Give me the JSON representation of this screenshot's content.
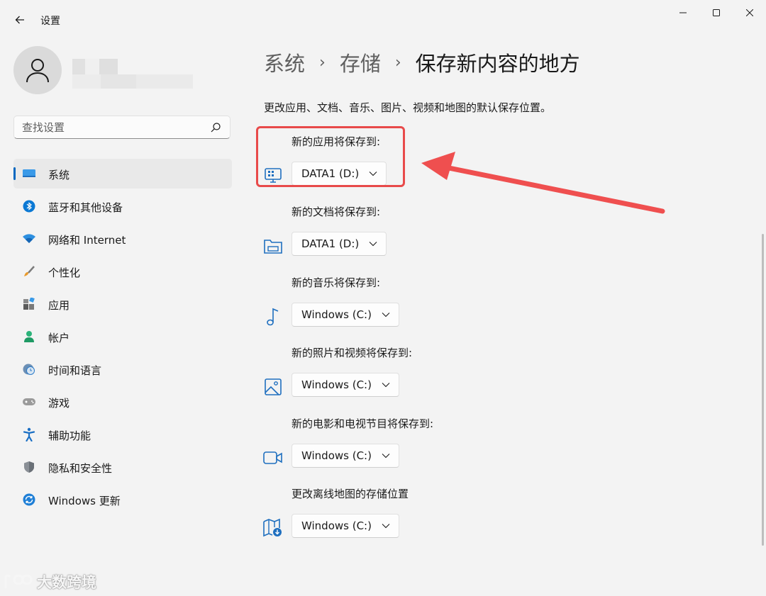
{
  "window": {
    "title": "设置",
    "controls": [
      "minimize-icon",
      "maximize-icon",
      "close-icon"
    ]
  },
  "search": {
    "placeholder": "查找设置"
  },
  "sidebar": {
    "items": [
      {
        "label": "系统",
        "icon": "monitor-icon",
        "active": true
      },
      {
        "label": "蓝牙和其他设备",
        "icon": "bluetooth-icon"
      },
      {
        "label": "网络和 Internet",
        "icon": "wifi-icon"
      },
      {
        "label": "个性化",
        "icon": "brush-icon"
      },
      {
        "label": "应用",
        "icon": "apps-icon"
      },
      {
        "label": "帐户",
        "icon": "account-icon"
      },
      {
        "label": "时间和语言",
        "icon": "clock-globe-icon"
      },
      {
        "label": "游戏",
        "icon": "gamepad-icon"
      },
      {
        "label": "辅助功能",
        "icon": "accessibility-icon"
      },
      {
        "label": "隐私和安全性",
        "icon": "shield-icon"
      },
      {
        "label": "Windows 更新",
        "icon": "update-icon"
      }
    ]
  },
  "breadcrumb": {
    "seg1": "系统",
    "seg2": "存储",
    "current": "保存新内容的地方"
  },
  "description": "更改应用、文档、音乐、图片、视频和地图的默认保存位置。",
  "settings": [
    {
      "label": "新的应用将保存到:",
      "value": "DATA1 (D:)",
      "icon": "app-install-icon"
    },
    {
      "label": "新的文档将保存到:",
      "value": "DATA1 (D:)",
      "icon": "folder-document-icon"
    },
    {
      "label": "新的音乐将保存到:",
      "value": "Windows (C:)",
      "icon": "music-note-icon"
    },
    {
      "label": "新的照片和视频将保存到:",
      "value": "Windows (C:)",
      "icon": "image-icon"
    },
    {
      "label": "新的电影和电视节目将保存到:",
      "value": "Windows (C:)",
      "icon": "video-camera-icon"
    },
    {
      "label": "更改离线地图的存储位置",
      "value": "Windows (C:)",
      "icon": "map-download-icon"
    }
  ],
  "watermark": "大数跨境",
  "colors": {
    "accent": "#0067c0",
    "highlight": "#e84a4a",
    "background": "#f3f3f3"
  }
}
